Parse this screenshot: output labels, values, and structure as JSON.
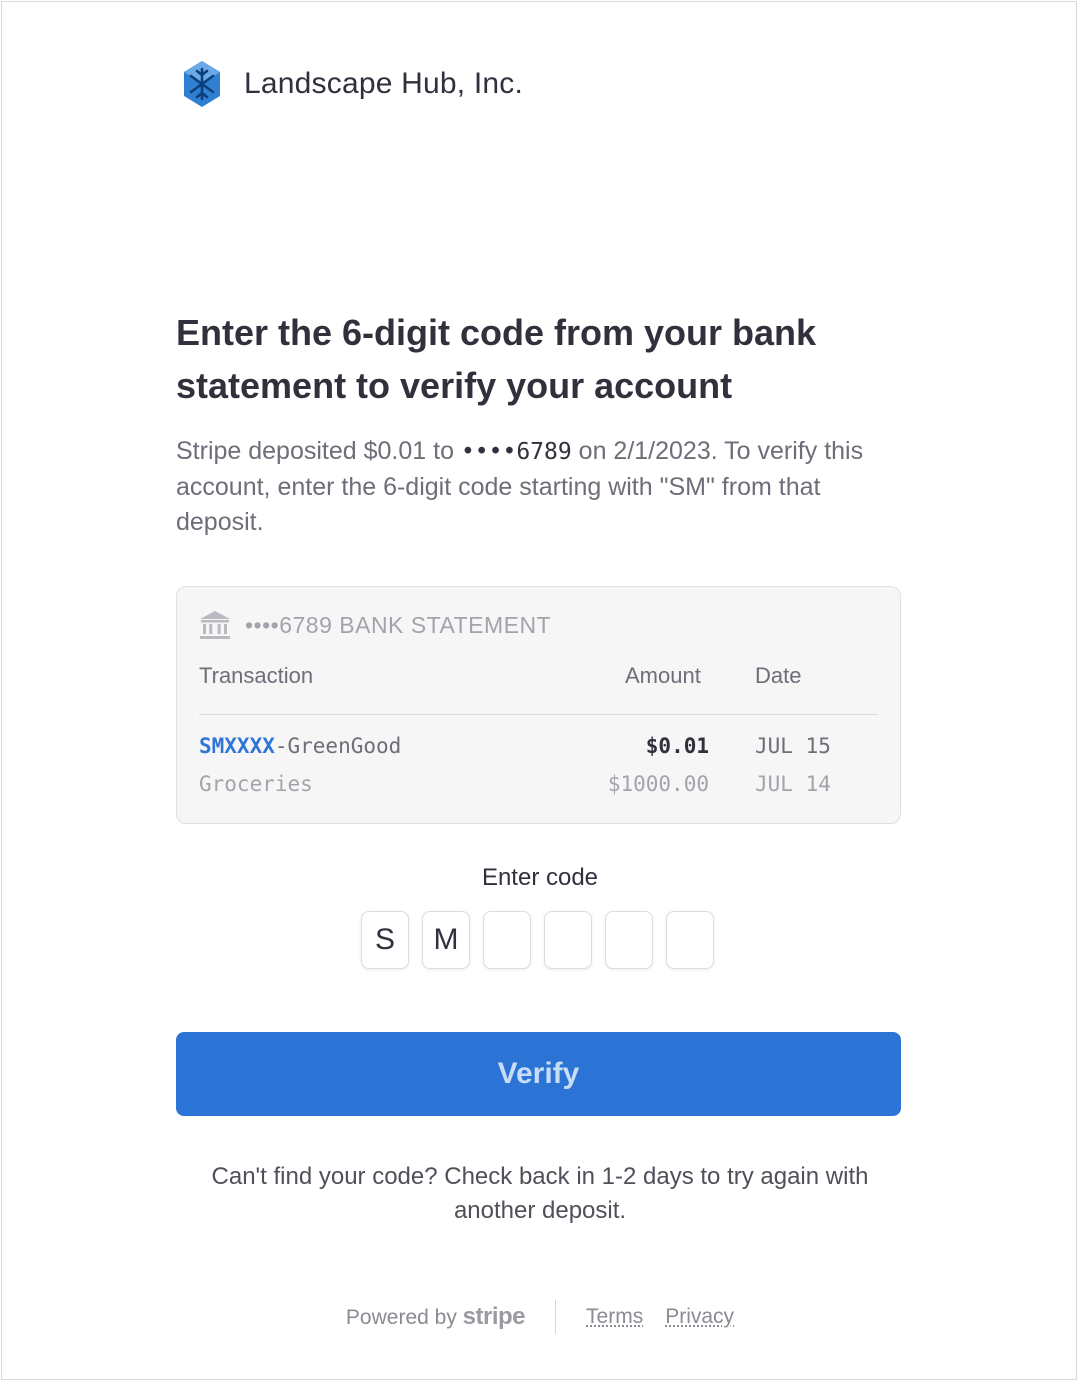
{
  "header": {
    "company_name": "Landscape Hub, Inc.",
    "logo_icon": "snowflake-logo-icon"
  },
  "title": "Enter the 6-digit code from your bank statement to verify your account",
  "description": {
    "before_account": "Stripe deposited $0.01 to ",
    "account_mask": "••••6789",
    "after_account": " on 2/1/2023. To verify this account, enter the 6-digit code starting with \"SM\" from that deposit."
  },
  "statement": {
    "bank_icon": "bank-icon",
    "title": "••••6789 BANK STATEMENT",
    "columns": {
      "transaction": "Transaction",
      "amount": "Amount",
      "date": "Date"
    },
    "rows": [
      {
        "code_prefix": "SMXXXX",
        "description": "-GreenGood",
        "amount": "$0.01",
        "date": "JUL 15"
      },
      {
        "code_prefix": "",
        "description": "Groceries",
        "amount": "$1000.00",
        "date": "JUL 14"
      }
    ]
  },
  "code_entry": {
    "label": "Enter code",
    "digits": [
      "S",
      "M",
      "",
      "",
      "",
      ""
    ]
  },
  "verify_button": {
    "label": "Verify"
  },
  "help_text": "Can't find your code? Check back in 1-2 days to try again with another deposit.",
  "footer": {
    "powered_by": "Powered by",
    "brand": "stripe",
    "terms": "Terms",
    "privacy": "Privacy"
  },
  "colors": {
    "accent": "#2b74d6",
    "code_highlight": "#2f76d6",
    "logo": "#2f7fd3"
  }
}
